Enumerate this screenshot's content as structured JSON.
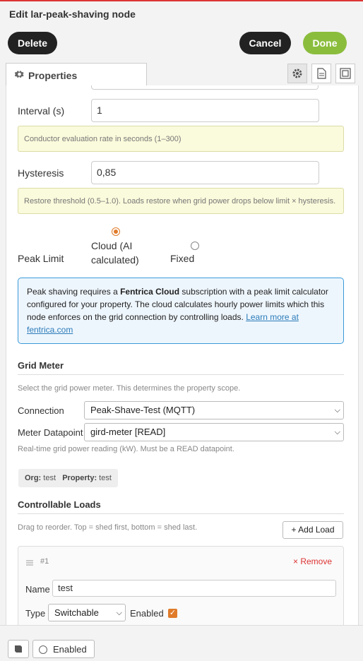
{
  "header": {
    "title": "Edit lar-peak-shaving node"
  },
  "toolbar": {
    "delete_label": "Delete",
    "cancel_label": "Cancel",
    "done_label": "Done"
  },
  "tabs": [
    {
      "label": "Properties",
      "icon": "gear-icon"
    }
  ],
  "side_buttons": [
    "gear-icon",
    "document-icon",
    "frame-icon"
  ],
  "fields": {
    "interval": {
      "label": "Interval (s)",
      "value": "1",
      "hint": "Conductor evaluation rate in seconds (1–300)"
    },
    "hysteresis": {
      "label": "Hysteresis",
      "value": "0,85",
      "hint": "Restore threshold (0.5–1.0). Loads restore when grid power drops below limit × hysteresis."
    },
    "peak_limit": {
      "label": "Peak Limit",
      "options": [
        {
          "line1": "Cloud (AI",
          "line2": "calculated)",
          "selected": true
        },
        {
          "line1": "Fixed",
          "selected": false
        }
      ]
    }
  },
  "info": {
    "part1": "Peak shaving requires a ",
    "bold": "Fentrica Cloud",
    "part2": " subscription with a peak limit calculator configured for your property. The cloud calculates hourly power limits which this node enforces on the grid connection by controlling loads. ",
    "link": "Learn more at fentrica.com"
  },
  "grid_meter": {
    "title": "Grid Meter",
    "description": "Select the grid power meter. This determines the property scope.",
    "connection_label": "Connection",
    "connection_value": "Peak-Shave-Test (MQTT)",
    "datapoint_label": "Meter Datapoint",
    "datapoint_value": "gird-meter [READ]",
    "datapoint_hint": "Real-time grid power reading (kW). Must be a READ datapoint.",
    "org_label": "Org:",
    "org_value": "test",
    "property_label": "Property:",
    "property_value": "test"
  },
  "loads": {
    "title": "Controllable Loads",
    "description": "Drag to reorder. Top = shed first, bottom = shed last.",
    "add_label": "+ Add Load",
    "items": [
      {
        "index": "#1",
        "remove_label": "× Remove",
        "name_label": "Name",
        "name_value": "test",
        "type_label": "Type",
        "type_value": "Switchable",
        "enabled_label": "Enabled",
        "enabled": true
      }
    ]
  },
  "footer": {
    "enabled_label": "Enabled"
  },
  "colors": {
    "accent": "#e07b2a",
    "done": "#8bbd3d",
    "info_border": "#3a9ad9",
    "danger": "#d33"
  }
}
